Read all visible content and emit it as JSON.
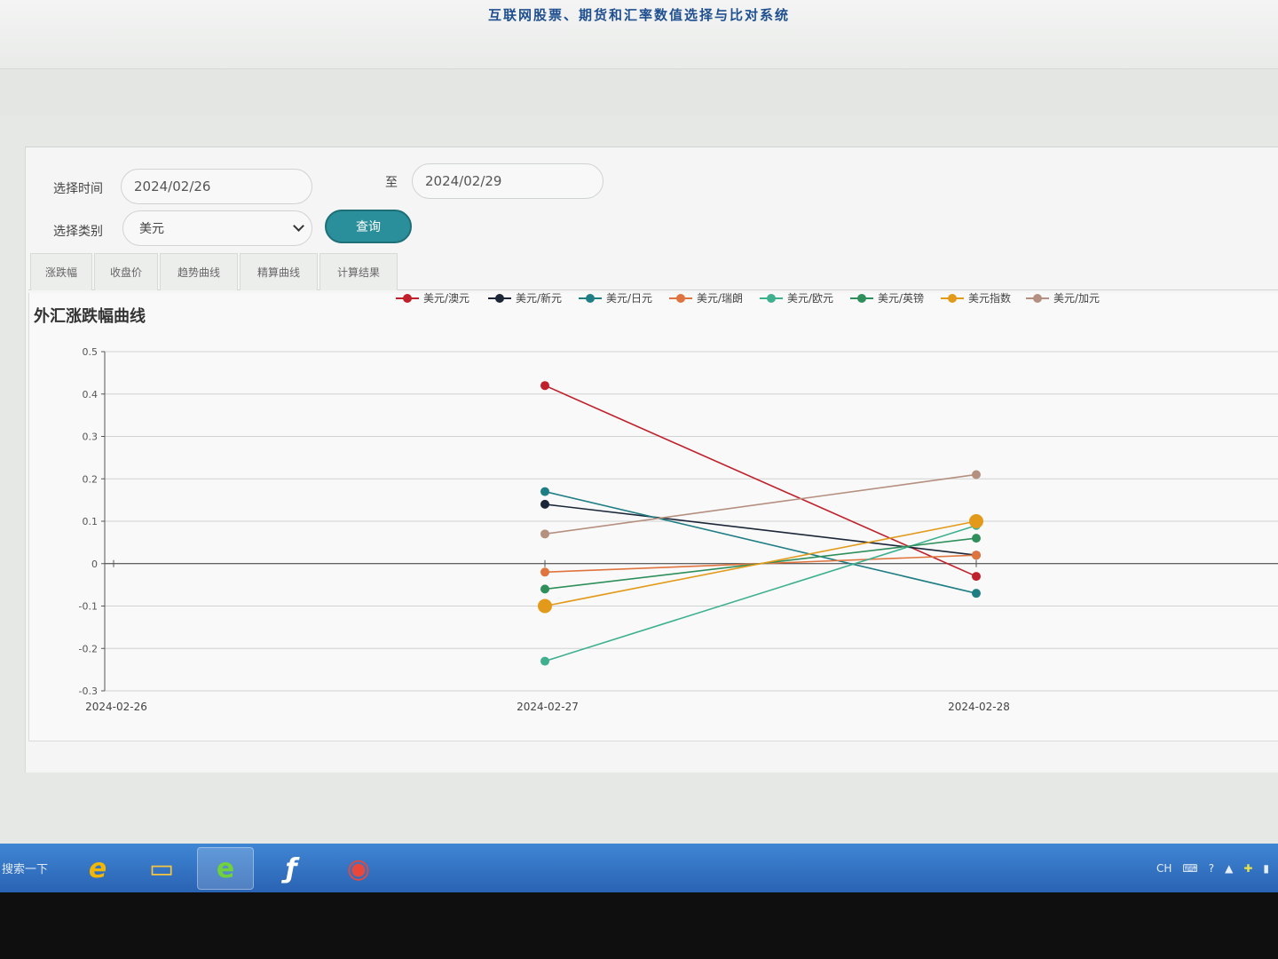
{
  "header": {
    "title": "互联网股票、期货和汇率数值选择与比对系统"
  },
  "filters": {
    "time_label": "选择时间",
    "start_date": "2024/02/26",
    "to_label": "至",
    "end_date": "2024/02/29",
    "category_label": "选择类别",
    "category_value": "美元",
    "query_label": "查询"
  },
  "tabs": [
    {
      "label": "涨跌幅"
    },
    {
      "label": "收盘价"
    },
    {
      "label": "趋势曲线"
    },
    {
      "label": "精算曲线"
    },
    {
      "label": "计算结果"
    }
  ],
  "chart_data": {
    "type": "line",
    "title": "外汇涨跌幅曲线",
    "x": [
      "2024-02-26",
      "2024-02-27",
      "2024-02-28"
    ],
    "ylim": [
      -0.3,
      0.5
    ],
    "yticks": [
      "0.5",
      "0.4",
      "0.3",
      "0.2",
      "0.1",
      "0",
      "-0.1",
      "-0.2",
      "-0.3"
    ],
    "legend_position": "top",
    "grid": true,
    "series": [
      {
        "name": "美元/澳元",
        "color": "#c0202b",
        "values": [
          null,
          0.42,
          -0.03
        ]
      },
      {
        "name": "美元/新元",
        "color": "#1b2638",
        "values": [
          null,
          0.14,
          0.02
        ]
      },
      {
        "name": "美元/日元",
        "color": "#1f7d84",
        "values": [
          null,
          0.17,
          -0.07
        ]
      },
      {
        "name": "美元/瑞朗",
        "color": "#e0743e",
        "values": [
          null,
          -0.02,
          0.02
        ]
      },
      {
        "name": "美元/欧元",
        "color": "#3fb08f",
        "values": [
          null,
          -0.23,
          0.09
        ]
      },
      {
        "name": "美元/英镑",
        "color": "#2e8f5a",
        "values": [
          null,
          -0.06,
          0.06
        ]
      },
      {
        "name": "美元指数",
        "color": "#e39a1a",
        "values": [
          null,
          -0.1,
          0.1
        ]
      },
      {
        "name": "美元/加元",
        "color": "#b58f7f",
        "values": [
          null,
          0.07,
          0.21
        ]
      }
    ]
  },
  "taskbar": {
    "search_label": "搜索一下",
    "apps": [
      {
        "name": "ie-browser-icon",
        "glyph": "e",
        "color": "#f2b705"
      },
      {
        "name": "file-explorer-icon",
        "glyph": "▭",
        "color": "#f5c542"
      },
      {
        "name": "browser-360-icon",
        "glyph": "e",
        "color": "#6fd13b"
      },
      {
        "name": "flash-icon",
        "glyph": "ƒ",
        "color": "#ffffff"
      },
      {
        "name": "chrome-icon",
        "glyph": "◉",
        "color": "#e8473b"
      }
    ],
    "tray_lang": "CH"
  }
}
